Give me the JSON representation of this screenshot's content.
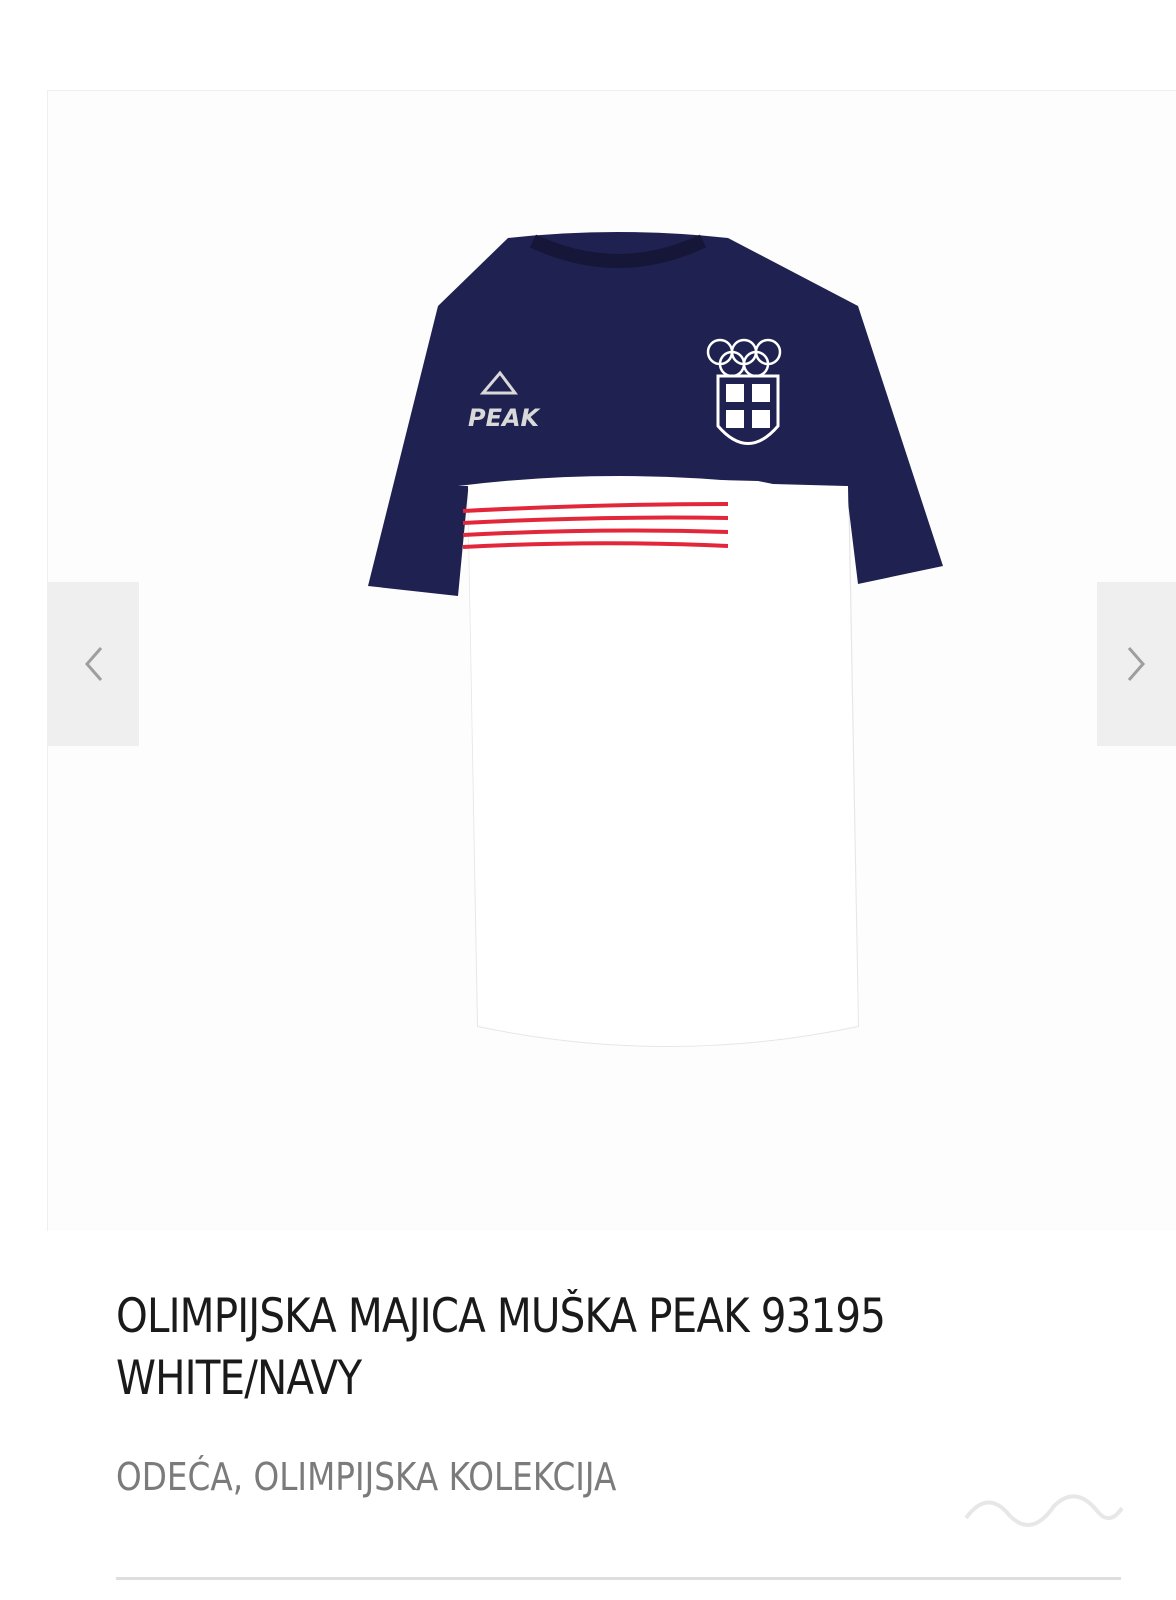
{
  "product": {
    "title_line1": "OLIMPIJSKA MAJICA MUŠKA PEAK 93195",
    "title_line2": "WHITE/NAVY",
    "categories": [
      "ODEĆA",
      "OLIMPIJSKA KOLEKCIJA"
    ],
    "category_separator": ", ",
    "image": {
      "primary_color": "#1f2150",
      "body_color": "#ffffff",
      "stripe_color": "#e2273b",
      "logo_text": "PEAK"
    }
  },
  "gallery": {
    "prev_icon": "chevron-left-icon",
    "next_icon": "chevron-right-icon"
  }
}
